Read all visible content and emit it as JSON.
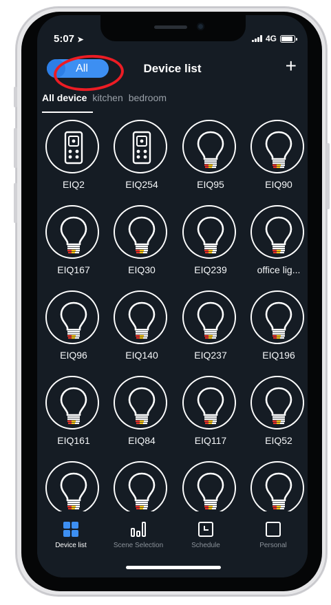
{
  "status": {
    "time": "5:07",
    "network": "4G"
  },
  "header": {
    "toggle_label": "All",
    "title": "Device list",
    "add_label": "+"
  },
  "tabs": [
    {
      "label": "All device",
      "active": true
    },
    {
      "label": "kitchen",
      "active": false
    },
    {
      "label": "bedroom",
      "active": false
    }
  ],
  "devices": [
    {
      "name": "EIQ2",
      "icon": "remote-icon"
    },
    {
      "name": "EIQ254",
      "icon": "remote-icon"
    },
    {
      "name": "EIQ95",
      "icon": "bulb-icon"
    },
    {
      "name": "EIQ90",
      "icon": "bulb-icon"
    },
    {
      "name": "EIQ167",
      "icon": "bulb-icon"
    },
    {
      "name": "EIQ30",
      "icon": "bulb-icon"
    },
    {
      "name": "EIQ239",
      "icon": "bulb-icon"
    },
    {
      "name": "office lig...",
      "icon": "bulb-icon"
    },
    {
      "name": "EIQ96",
      "icon": "bulb-icon"
    },
    {
      "name": "EIQ140",
      "icon": "bulb-icon"
    },
    {
      "name": "EIQ237",
      "icon": "bulb-icon"
    },
    {
      "name": "EIQ196",
      "icon": "bulb-icon"
    },
    {
      "name": "EIQ161",
      "icon": "bulb-icon"
    },
    {
      "name": "EIQ84",
      "icon": "bulb-icon"
    },
    {
      "name": "EIQ117",
      "icon": "bulb-icon"
    },
    {
      "name": "EIQ52",
      "icon": "bulb-icon"
    },
    {
      "name": "",
      "icon": "bulb-icon"
    },
    {
      "name": "",
      "icon": "bulb-icon"
    },
    {
      "name": "",
      "icon": "bulb-icon"
    },
    {
      "name": "",
      "icon": "bulb-icon"
    }
  ],
  "nav": [
    {
      "label": "Device list",
      "icon": "grid-icon",
      "active": true
    },
    {
      "label": "Scene Selection",
      "icon": "bar-chart-icon",
      "active": false
    },
    {
      "label": "Schedule",
      "icon": "schedule-icon",
      "active": false
    },
    {
      "label": "Personal",
      "icon": "personal-icon",
      "active": false
    }
  ],
  "colors": {
    "background": "#151c24",
    "accent": "#3d8ff2",
    "highlight_ring": "#ec1c24",
    "bulb_red": "#e8332a",
    "bulb_yellow": "#f5c518"
  }
}
